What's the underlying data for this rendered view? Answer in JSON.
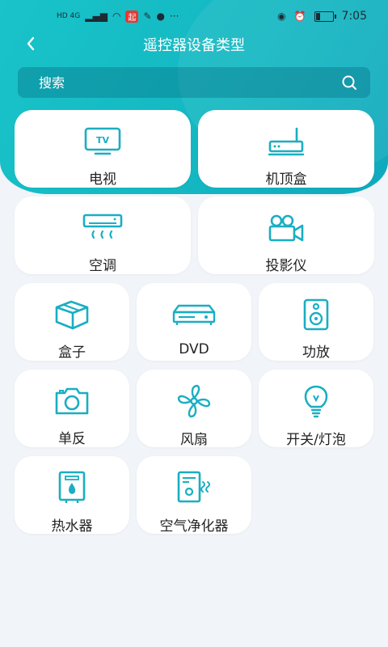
{
  "status": {
    "time": "7:05",
    "network": "HD 4G",
    "app_badge": "起"
  },
  "header": {
    "title": "遥控器设备类型"
  },
  "search": {
    "placeholder": "搜索"
  },
  "devices": [
    {
      "label": "电视",
      "icon": "tv-icon"
    },
    {
      "label": "机顶盒",
      "icon": "set-top-box-icon"
    },
    {
      "label": "空调",
      "icon": "air-conditioner-icon"
    },
    {
      "label": "投影仪",
      "icon": "projector-icon"
    },
    {
      "label": "盒子",
      "icon": "box-icon"
    },
    {
      "label": "DVD",
      "icon": "dvd-player-icon"
    },
    {
      "label": "功放",
      "icon": "speaker-icon"
    },
    {
      "label": "单反",
      "icon": "camera-icon"
    },
    {
      "label": "风扇",
      "icon": "fan-icon"
    },
    {
      "label": "开关/灯泡",
      "icon": "light-bulb-icon"
    },
    {
      "label": "热水器",
      "icon": "water-heater-icon"
    },
    {
      "label": "空气净化器",
      "icon": "air-purifier-icon"
    }
  ],
  "colors": {
    "accent": "#1ab8c6",
    "icon": "#1aaec2"
  }
}
